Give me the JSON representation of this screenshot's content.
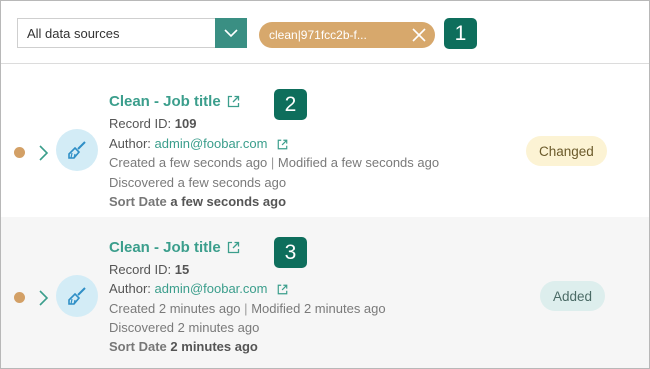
{
  "toolbar": {
    "source_select": {
      "value": "All data sources"
    },
    "filter_chip": {
      "label": "clean|971fcc2b-f..."
    }
  },
  "callouts": [
    "1",
    "2",
    "3"
  ],
  "records": [
    {
      "title": "Clean - Job title",
      "record_id_label": "Record ID:",
      "record_id": "109",
      "author_label": "Author:",
      "author": "admin@foobar.com",
      "created_label": "Created",
      "created": "a few seconds ago",
      "modified_label": "Modified",
      "modified": "a few seconds ago",
      "discovered_label": "Discovered",
      "discovered": "a few seconds ago",
      "sort_date_label": "Sort Date",
      "sort_date": "a few seconds ago",
      "status": "Changed"
    },
    {
      "title": "Clean - Job title",
      "record_id_label": "Record ID:",
      "record_id": "15",
      "author_label": "Author:",
      "author": "admin@foobar.com",
      "created_label": "Created",
      "created": "2 minutes ago",
      "modified_label": "Modified",
      "modified": "2 minutes ago",
      "discovered_label": "Discovered",
      "discovered": "2 minutes ago",
      "sort_date_label": "Sort Date",
      "sort_date": "2 minutes ago",
      "status": "Added"
    }
  ],
  "colors": {
    "accent": "#3b9e8c",
    "callout": "#0e6e5c",
    "chip": "#d7a86c",
    "status_changed_bg": "#fcf3d4",
    "status_added_bg": "#ddeeed"
  }
}
